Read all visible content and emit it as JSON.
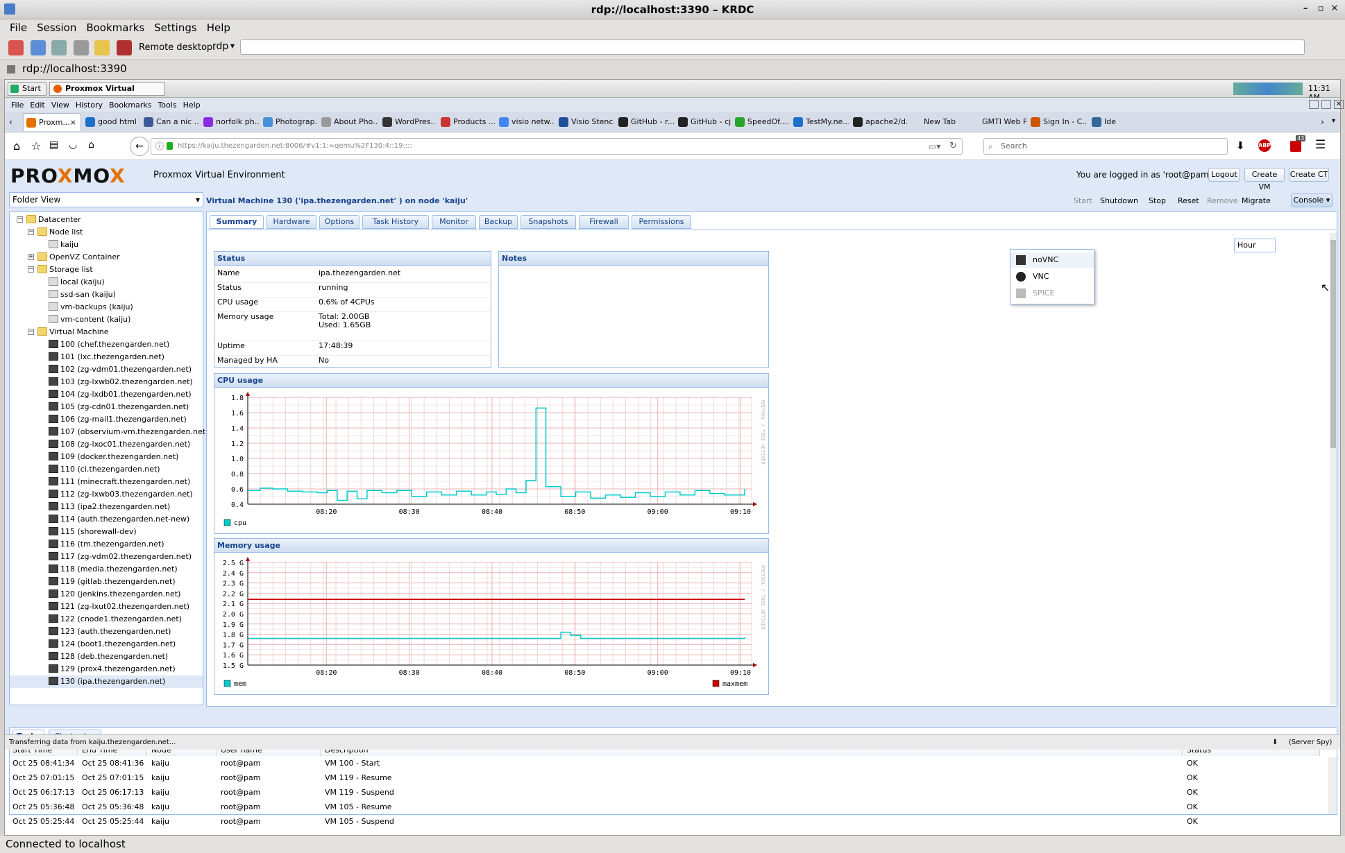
{
  "krdc": {
    "title": "rdp://localhost:3390 – KRDC",
    "menu": [
      "File",
      "Session",
      "Bookmarks",
      "Settings",
      "Help"
    ],
    "remote_label": "Remote desktop:",
    "protocol": "rdp",
    "tab": "rdp://localhost:3390",
    "status": "Connected to localhost"
  },
  "taskbar": {
    "start": "Start",
    "window": "Proxmox Virtual Envir...",
    "clock": "11:31 AM"
  },
  "firefox": {
    "menu": [
      "File",
      "Edit",
      "View",
      "History",
      "Bookmarks",
      "Tools",
      "Help"
    ],
    "tabs": [
      {
        "label": "Proxm...",
        "color": "#e57000",
        "active": true
      },
      {
        "label": "good html ...",
        "color": "#1e6fc8"
      },
      {
        "label": "Can a nic ...",
        "color": "#3b5998"
      },
      {
        "label": "norfolk ph...",
        "color": "#8a2be2"
      },
      {
        "label": "Photograp...",
        "color": "#4a90d9"
      },
      {
        "label": "About Pho...",
        "color": "#999999"
      },
      {
        "label": "WordPres...",
        "color": "#333333"
      },
      {
        "label": "Products ...",
        "color": "#cc3333"
      },
      {
        "label": "visio netw...",
        "color": "#4285f4"
      },
      {
        "label": "Visio Stenc...",
        "color": "#1e4e9c"
      },
      {
        "label": "GitHub - r...",
        "color": "#222222"
      },
      {
        "label": "GitHub - cj...",
        "color": "#222222"
      },
      {
        "label": "SpeedOf....",
        "color": "#2aa52a"
      },
      {
        "label": "TestMy.ne...",
        "color": "#1e6fc8"
      },
      {
        "label": "apache2/d...",
        "color": "#222222"
      },
      {
        "label": "New Tab",
        "color": "#d6dce8"
      },
      {
        "label": "GMTI Web Pro...",
        "color": "#d6dce8"
      },
      {
        "label": "Sign In - C...",
        "color": "#cc5500"
      },
      {
        "label": "Ide",
        "color": "#336699"
      }
    ],
    "url": "https://kaiju.thezengarden.net:8006/#v1:1:=qemu%2F130:4::19::::",
    "search_placeholder": "Search",
    "badge": "43",
    "status": "Transferring data from kaiju.thezengarden.net...",
    "server_spy": "(Server Spy)"
  },
  "pve": {
    "product": "Proxmox Virtual Environment",
    "logged_in": "You are logged in as 'root@pam'",
    "logout": "Logout",
    "create_vm": "Create VM",
    "create_ct": "Create CT",
    "view": "Folder View",
    "vm_title": "Virtual Machine 130 ('ipa.thezengarden.net' ) on node 'kaiju'",
    "actions": [
      "Start",
      "Shutdown",
      "Stop",
      "Reset",
      "Remove",
      "Migrate"
    ],
    "console": "Console",
    "console_menu": [
      "noVNC",
      "VNC",
      "SPICE"
    ],
    "timeframe": "Hour",
    "tabs": [
      "Summary",
      "Hardware",
      "Options",
      "Task History",
      "Monitor",
      "Backup",
      "Snapshots",
      "Firewall",
      "Permissions"
    ],
    "tree": {
      "datacenter": "Datacenter",
      "node_list": "Node list",
      "node": "kaiju",
      "openvz": "OpenVZ Container",
      "storage_list": "Storage list",
      "storage": [
        "local (kaiju)",
        "ssd-san (kaiju)",
        "vm-backups (kaiju)",
        "vm-content (kaiju)"
      ],
      "vm_folder": "Virtual Machine",
      "vms": [
        "100 (chef.thezengarden.net)",
        "101 (lxc.thezengarden.net)",
        "102 (zg-vdm01.thezengarden.net)",
        "103 (zg-lxwb02.thezengarden.net)",
        "104 (zg-lxdb01.thezengarden.net)",
        "105 (zg-cdn01.thezengarden.net)",
        "106 (zg-mail1.thezengarden.net)",
        "107 (observium-vm.thezengarden.net)",
        "108 (zg-lxoc01.thezengarden.net)",
        "109 (docker.thezengarden.net)",
        "110 (ci.thezengarden.net)",
        "111 (minecraft.thezengarden.net)",
        "112 (zg-lxwb03.thezengarden.net)",
        "113 (ipa2.thezengarden.net)",
        "114 (auth.thezengarden.net-new)",
        "115 (shorewall-dev)",
        "116 (tm.thezengarden.net)",
        "117 (zg-vdm02.thezengarden.net)",
        "118 (media.thezengarden.net)",
        "119 (gitlab.thezengarden.net)",
        "120 (jenkins.thezengarden.net)",
        "121 (zg-lxut02.thezengarden.net)",
        "122 (cnode1.thezengarden.net)",
        "123 (auth.thezengarden.net)",
        "124 (boot1.thezengarden.net)",
        "128 (deb.thezengarden.net)",
        "129 (prox4.thezengarden.net)",
        "130 (ipa.thezengarden.net)"
      ]
    },
    "status_panel": {
      "title": "Status",
      "rows": [
        {
          "k": "Name",
          "v": "ipa.thezengarden.net"
        },
        {
          "k": "Status",
          "v": "running"
        },
        {
          "k": "CPU usage",
          "v": "0.6% of 4CPUs"
        },
        {
          "k": "Memory usage",
          "v": "Total: 2.00GB",
          "v2": "Used: 1.65GB"
        },
        {
          "k": "Uptime",
          "v": "17:48:39"
        },
        {
          "k": "Managed by HA",
          "v": "No"
        }
      ]
    },
    "notes_title": "Notes",
    "cpu_title": "CPU usage",
    "mem_title": "Memory usage",
    "rrd_watermark": "RRDTOOL / TOBI OETIKER",
    "bottom_tabs": [
      "Tasks",
      "Cluster log"
    ],
    "task_columns": [
      "Start Time",
      "End Time",
      "Node",
      "User name",
      "Description",
      "Status"
    ],
    "tasks": [
      [
        "Oct 25 08:41:34",
        "Oct 25 08:41:36",
        "kaiju",
        "root@pam",
        "VM 100 - Start",
        "OK"
      ],
      [
        "Oct 25 07:01:15",
        "Oct 25 07:01:15",
        "kaiju",
        "root@pam",
        "VM 119 - Resume",
        "OK"
      ],
      [
        "Oct 25 06:17:13",
        "Oct 25 06:17:13",
        "kaiju",
        "root@pam",
        "VM 119 - Suspend",
        "OK"
      ],
      [
        "Oct 25 05:36:48",
        "Oct 25 05:36:48",
        "kaiju",
        "root@pam",
        "VM 105 - Resume",
        "OK"
      ],
      [
        "Oct 25 05:25:44",
        "Oct 25 05:25:44",
        "kaiju",
        "root@pam",
        "VM 105 - Suspend",
        "OK"
      ]
    ]
  },
  "chart_data": [
    {
      "type": "line",
      "ylim": [
        0.4,
        1.8
      ],
      "yticks": [
        "0.4",
        "0.6",
        "0.8",
        "1.0",
        "1.2",
        "1.4",
        "1.6",
        "1.8"
      ],
      "xticks": [
        "08:20",
        "08:30",
        "08:40",
        "08:50",
        "09:00",
        "09:10"
      ],
      "series": [
        {
          "name": "cpu",
          "color": "#00cccc",
          "x": [
            0,
            0.025,
            0.05,
            0.08,
            0.11,
            0.14,
            0.16,
            0.18,
            0.2,
            0.22,
            0.24,
            0.27,
            0.3,
            0.33,
            0.36,
            0.39,
            0.42,
            0.45,
            0.48,
            0.5,
            0.52,
            0.54,
            0.56,
            0.58,
            0.6,
            0.63,
            0.66,
            0.69,
            0.72,
            0.75,
            0.78,
            0.81,
            0.84,
            0.87,
            0.9,
            0.93,
            0.96,
            1.0
          ],
          "values": [
            0.58,
            0.61,
            0.6,
            0.57,
            0.56,
            0.55,
            0.58,
            0.45,
            0.57,
            0.47,
            0.58,
            0.55,
            0.58,
            0.5,
            0.56,
            0.52,
            0.57,
            0.52,
            0.56,
            0.53,
            0.6,
            0.55,
            0.71,
            1.66,
            0.63,
            0.5,
            0.56,
            0.48,
            0.52,
            0.49,
            0.55,
            0.5,
            0.56,
            0.52,
            0.58,
            0.54,
            0.52,
            0.6
          ]
        }
      ]
    },
    {
      "type": "line",
      "ylim": [
        1.5,
        2.5
      ],
      "yticks": [
        "1.5 G",
        "1.6 G",
        "1.7 G",
        "1.8 G",
        "1.9 G",
        "2.0 G",
        "2.1 G",
        "2.2 G",
        "2.3 G",
        "2.4 G",
        "2.5 G"
      ],
      "xticks": [
        "08:20",
        "08:30",
        "08:40",
        "08:50",
        "09:00",
        "09:10"
      ],
      "series": [
        {
          "name": "mem",
          "color": "#00cccc",
          "x": [
            0,
            0.6,
            0.63,
            0.65,
            0.67,
            0.7,
            1.0
          ],
          "values": [
            1.76,
            1.76,
            1.82,
            1.79,
            1.76,
            1.76,
            1.77
          ]
        },
        {
          "name": "maxmem",
          "color": "#cc0000",
          "x": [
            0,
            1.0
          ],
          "values": [
            2.14,
            2.14
          ]
        }
      ]
    }
  ]
}
